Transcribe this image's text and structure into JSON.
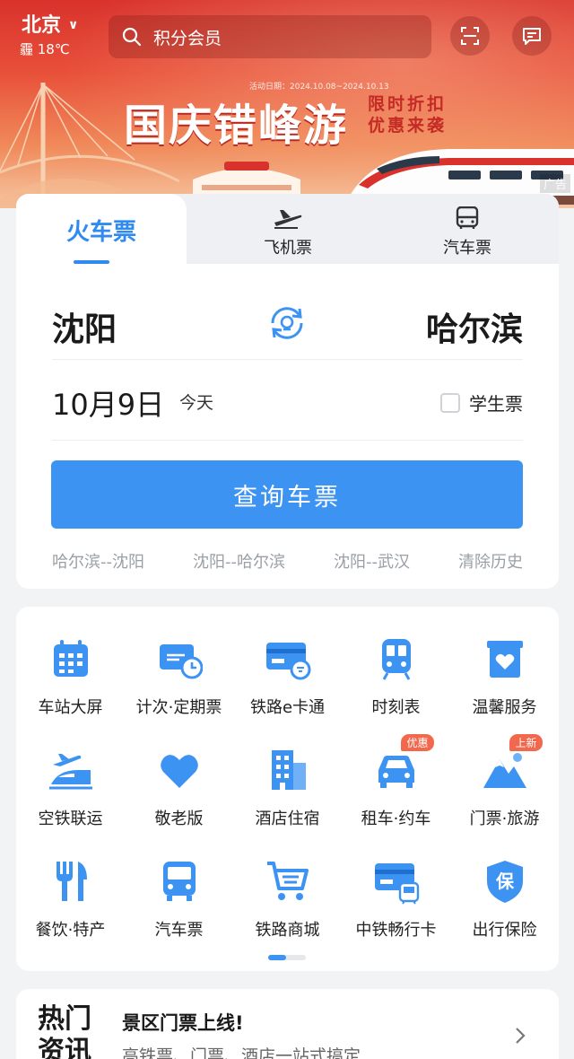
{
  "header": {
    "city": "北京",
    "weather": "霾 18℃",
    "search_placeholder": "积分会员"
  },
  "banner": {
    "date_text": "活动日期：2024.10.08~2024.10.13",
    "title": "国庆错峰游",
    "subtitle_line1": "限时折扣",
    "subtitle_line2": "优惠来袭",
    "ad_label": "广告"
  },
  "booking": {
    "tabs": [
      {
        "label": "火车票",
        "icon": "train-icon",
        "active": true
      },
      {
        "label": "飞机票",
        "icon": "plane-icon",
        "active": false
      },
      {
        "label": "汽车票",
        "icon": "bus-icon",
        "active": false
      }
    ],
    "from_city": "沈阳",
    "to_city": "哈尔滨",
    "date": "10月9日",
    "date_note": "今天",
    "student_label": "学生票",
    "search_button": "查询车票",
    "history": [
      "哈尔滨--沈阳",
      "沈阳--哈尔滨",
      "沈阳--武汉",
      "清除历史"
    ]
  },
  "services": [
    {
      "label": "车站大屏",
      "icon": "calendar-screen-icon",
      "badge": ""
    },
    {
      "label": "计次·定期票",
      "icon": "ticket-clock-icon",
      "badge": ""
    },
    {
      "label": "铁路e卡通",
      "icon": "ecard-icon",
      "badge": ""
    },
    {
      "label": "时刻表",
      "icon": "train-front-icon",
      "badge": ""
    },
    {
      "label": "温馨服务",
      "icon": "heart-gift-icon",
      "badge": ""
    },
    {
      "label": "空铁联运",
      "icon": "plane-train-icon",
      "badge": ""
    },
    {
      "label": "敬老版",
      "icon": "heart-icon",
      "badge": ""
    },
    {
      "label": "酒店住宿",
      "icon": "hotel-icon",
      "badge": ""
    },
    {
      "label": "租车·约车",
      "icon": "car-icon",
      "badge": "优惠"
    },
    {
      "label": "门票·旅游",
      "icon": "mountain-icon",
      "badge": "上新"
    },
    {
      "label": "餐饮·特产",
      "icon": "fork-knife-icon",
      "badge": ""
    },
    {
      "label": "汽车票",
      "icon": "bus-icon",
      "badge": ""
    },
    {
      "label": "铁路商城",
      "icon": "cart-icon",
      "badge": ""
    },
    {
      "label": "中铁畅行卡",
      "icon": "card-train-icon",
      "badge": ""
    },
    {
      "label": "出行保险",
      "icon": "shield-icon",
      "badge": ""
    }
  ],
  "news": {
    "tag_line1": "热门",
    "tag_line2": "资讯",
    "title": "景区门票上线!",
    "subtitle": "高铁票、门票、酒店一站式搞定"
  },
  "colors": {
    "accent": "#3d93f2",
    "banner_red": "#d9322c",
    "badge": "#f2684d"
  }
}
